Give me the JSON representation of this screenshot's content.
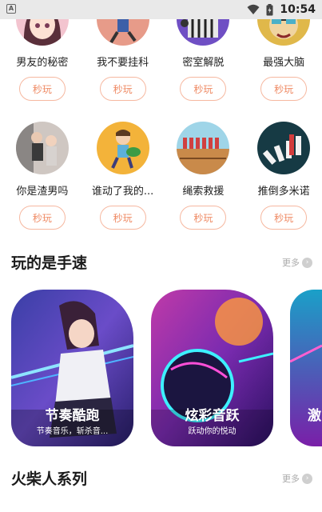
{
  "status_bar": {
    "time": "10:54",
    "left_icon": "A"
  },
  "games_row1": [
    {
      "name": "男友的秘密",
      "play": "秒玩",
      "icon": "anime-girl-icon"
    },
    {
      "name": "我不要挂科",
      "play": "秒玩",
      "icon": "running-boy-icon"
    },
    {
      "name": "密室解脱",
      "play": "秒玩",
      "icon": "prison-bars-icon"
    },
    {
      "name": "最强大脑",
      "play": "秒玩",
      "icon": "brain-puzzle-icon"
    }
  ],
  "games_row2": [
    {
      "name": "你是渣男吗",
      "play": "秒玩",
      "icon": "couple-icon"
    },
    {
      "name": "谁动了我的...",
      "play": "秒玩",
      "icon": "boy-watermelon-icon"
    },
    {
      "name": "绳索救援",
      "play": "秒玩",
      "icon": "rope-rescue-icon"
    },
    {
      "name": "推倒多米诺",
      "play": "秒玩",
      "icon": "domino-icon"
    }
  ],
  "section_speed": {
    "title": "玩的是手速",
    "more": "更多"
  },
  "speed_cards": [
    {
      "title": "节奏酷跑",
      "subtitle": "节奏音乐，斩杀音..."
    },
    {
      "title": "炫彩音跃",
      "subtitle": "跃动你的悦动"
    },
    {
      "title": "激",
      "subtitle": ""
    }
  ],
  "section_stickman": {
    "title": "火柴人系列",
    "more": "更多"
  },
  "colors": {
    "accent": "#ef8a64",
    "button_border": "#f6b8a0"
  }
}
